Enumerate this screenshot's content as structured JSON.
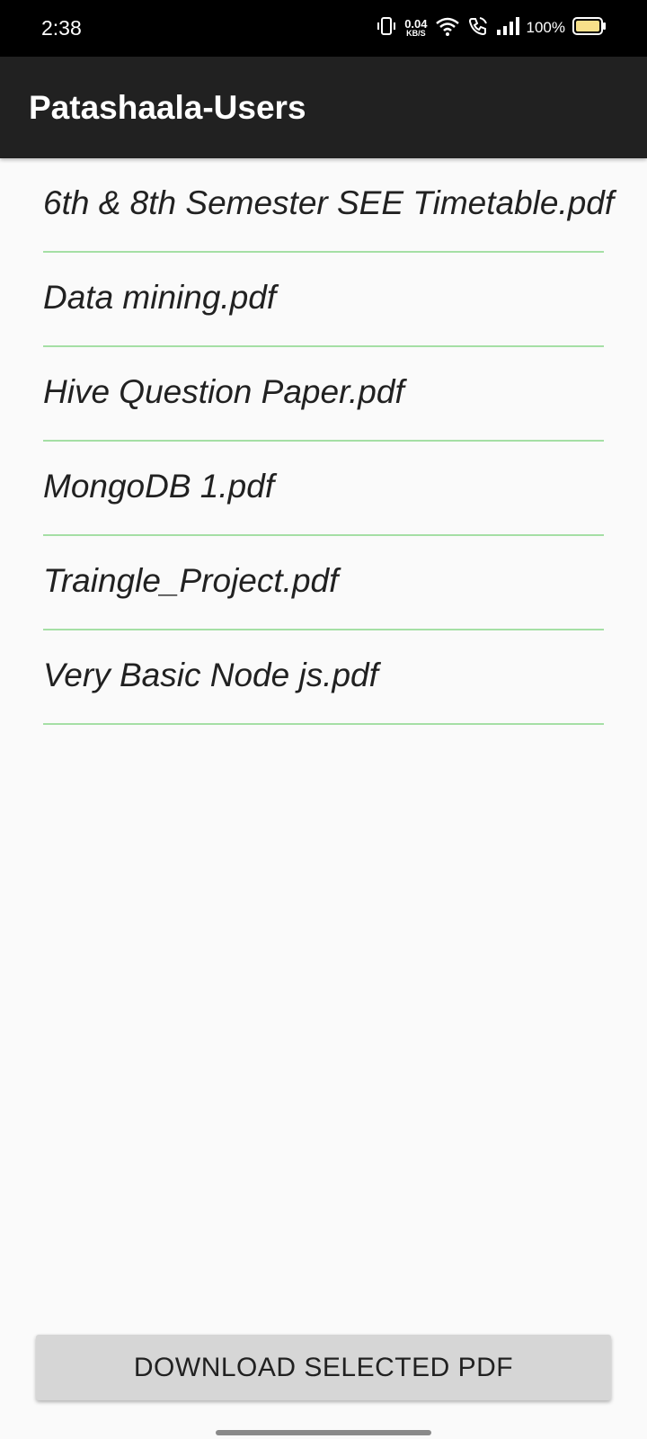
{
  "status_bar": {
    "time": "2:38",
    "net_speed_value": "0.04",
    "net_speed_unit": "KB/S",
    "battery_percent": "100%",
    "icons": [
      "vibrate-icon",
      "wifi-icon",
      "wifi-calling-icon",
      "signal-icon",
      "battery-icon"
    ]
  },
  "app_bar": {
    "title": "Patashaala-Users"
  },
  "files": [
    "6th & 8th Semester SEE Timetable.pdf",
    "Data mining.pdf",
    "Hive Question Paper.pdf",
    "MongoDB 1.pdf",
    "Traingle_Project.pdf",
    "Very Basic Node js.pdf"
  ],
  "actions": {
    "download_label": "DOWNLOAD SELECTED PDF"
  },
  "colors": {
    "app_bar": "#212121",
    "divider": "#a5dfa5",
    "button": "#d6d6d6",
    "battery_fill": "#f7e08a"
  }
}
